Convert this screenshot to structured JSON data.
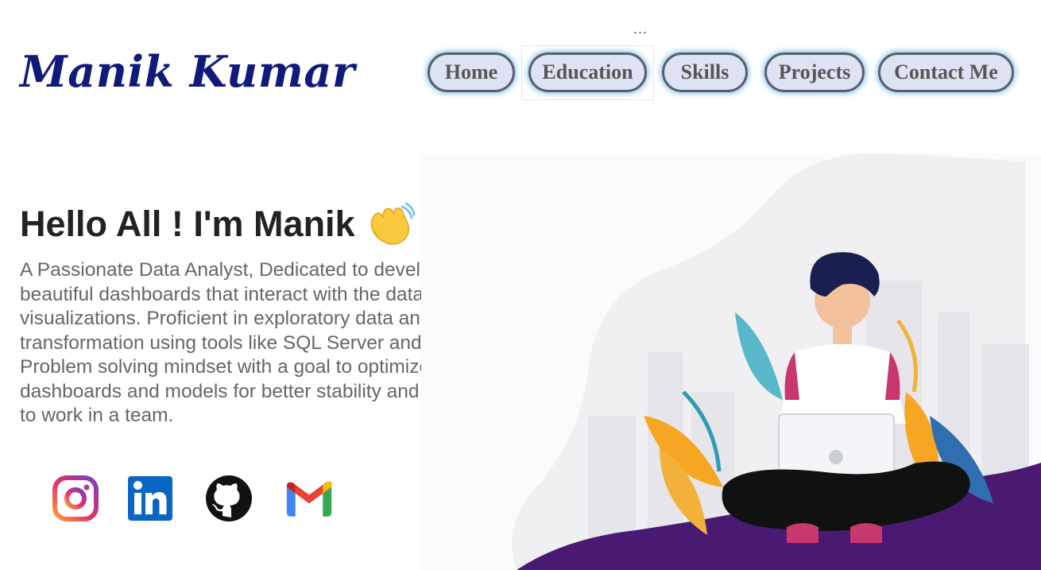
{
  "header": {
    "brand": "Manik Kumar",
    "ellipsis": "...",
    "nav": [
      {
        "label": "Home"
      },
      {
        "label": "Education"
      },
      {
        "label": "Skills"
      },
      {
        "label": "Projects"
      },
      {
        "label": "Contact Me"
      }
    ]
  },
  "hero": {
    "title": "Hello All ! I'm Manik",
    "wave_icon": "waving-hand-icon",
    "bio": "A Passionate Data Analyst, Dedicated to developing beautiful dashboards that interact with the data and visualizations. Proficient in exploratory data analysis, data transformation using tools like SQL Server and Alteryx. Problem solving mindset with a goal to optimize my dashboards and models for better stability and speed. Love to work in a team."
  },
  "social": [
    {
      "name": "instagram-icon"
    },
    {
      "name": "linkedin-icon"
    },
    {
      "name": "github-icon"
    },
    {
      "name": "gmail-icon"
    }
  ],
  "illustration": {
    "name": "person-with-laptop-illustration"
  },
  "colors": {
    "brand": "#0f1a7a",
    "nav_bg": "#dde3f3",
    "nav_glow": "#8fc7f2",
    "hill": "#4a1a72",
    "linkedin": "#0a66c2"
  }
}
